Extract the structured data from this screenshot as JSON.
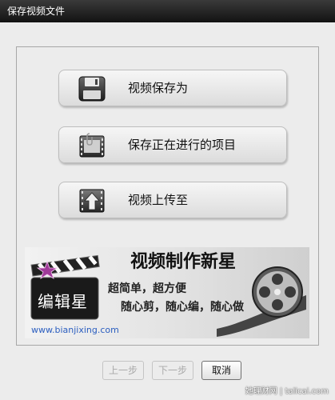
{
  "window": {
    "title": "保存视频文件"
  },
  "actions": [
    {
      "label": "视频保存为",
      "icon": "save-disk-icon"
    },
    {
      "label": "保存正在进行的项目",
      "icon": "film-project-icon"
    },
    {
      "label": "视频上传至",
      "icon": "upload-arrow-icon"
    }
  ],
  "banner": {
    "logo_text": "编辑星",
    "headline": "视频制作新星",
    "line1": "超简单，超方便",
    "line2": "随心剪，随心编，随心做",
    "url": "www.bianjixing.com"
  },
  "buttons": {
    "prev": "上一步",
    "next": "下一步",
    "cancel": "取消"
  },
  "watermark": "她理财网 | talicai.com"
}
